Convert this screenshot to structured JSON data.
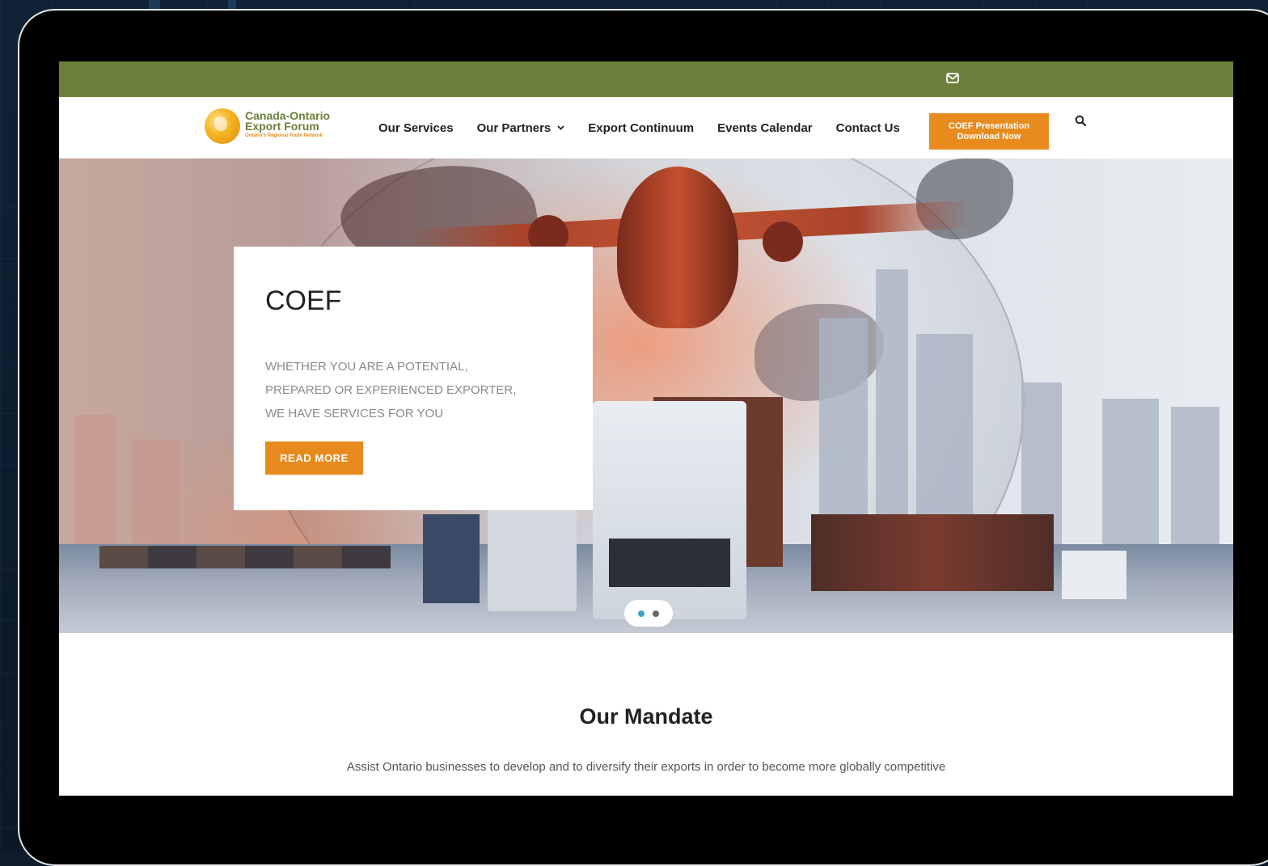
{
  "topbar": {
    "icon": "mail-icon"
  },
  "logo": {
    "line1": "Canada-Ontario",
    "line2": "Export Forum",
    "tagline": "Ontario's Regional Trade Network"
  },
  "nav": {
    "items": [
      {
        "label": "Our Services"
      },
      {
        "label": "Our Partners"
      },
      {
        "label": "Export Continuum"
      },
      {
        "label": "Events Calendar"
      },
      {
        "label": "Contact Us"
      }
    ],
    "cta_line1": "COEF Presentation",
    "cta_line2": "Download Now"
  },
  "hero": {
    "title": "COEF",
    "text_line1": "WHETHER YOU ARE A POTENTIAL,",
    "text_line2": "PREPARED OR EXPERIENCED EXPORTER,",
    "text_line3": "WE HAVE SERVICES FOR YOU",
    "button": "READ MORE",
    "slides": 2,
    "active_slide": 1
  },
  "mandate": {
    "title": "Our Mandate",
    "text": "Assist Ontario businesses to develop and to diversify their exports in order to become more globally competitive"
  },
  "colors": {
    "topbar": "#6b7f3a",
    "accent": "#e88b1e",
    "pager_active": "#3aa6c6"
  }
}
